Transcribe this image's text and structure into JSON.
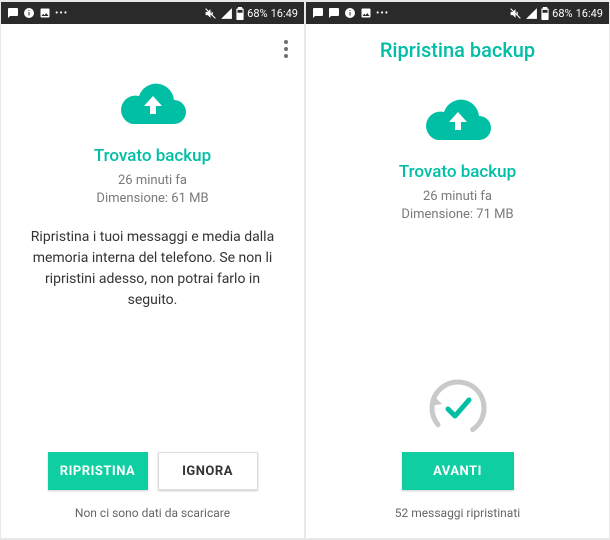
{
  "statusBar": {
    "battery_pct": "68%",
    "time": "16:49"
  },
  "colors": {
    "accent": "#00bfa5",
    "button": "#0fcfa2"
  },
  "screen1": {
    "heading": "Trovato backup",
    "time_ago": "26 minuti fa",
    "size_line": "Dimensione: 61 MB",
    "description": "Ripristina i tuoi messaggi e media dalla memoria interna del telefono. Se non li ripristini adesso, non potrai farlo in seguito.",
    "primary_btn": "RIPRISTINA",
    "secondary_btn": "IGNORA",
    "bottom_caption": "Non ci sono dati da scaricare"
  },
  "screen2": {
    "title": "Ripristina backup",
    "heading": "Trovato backup",
    "time_ago": "26 minuti fa",
    "size_line": "Dimensione: 71 MB",
    "primary_btn": "AVANTI",
    "bottom_caption": "52 messaggi ripristinati"
  }
}
